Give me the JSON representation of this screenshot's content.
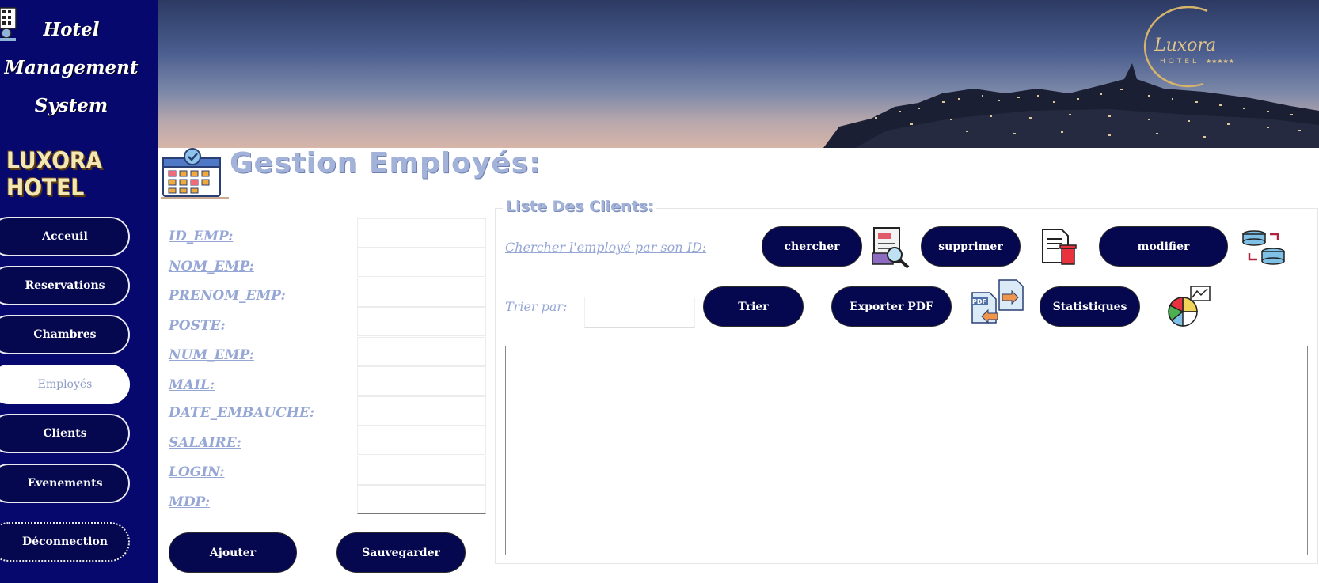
{
  "app": {
    "title_line1": "Hotel",
    "title_line2": "Management",
    "title_line3": "System",
    "brand": "LUXORA HOTEL"
  },
  "sidebar": {
    "items": [
      {
        "label": "Acceuil"
      },
      {
        "label": "Reservations"
      },
      {
        "label": "Chambres"
      },
      {
        "label": "Employés",
        "active": true
      },
      {
        "label": "Clients"
      },
      {
        "label": "Evenements"
      },
      {
        "label": "Déconnection"
      }
    ]
  },
  "header": {
    "logo_script": "Luxora",
    "logo_sub": "HOTEL",
    "logo_stars": "★★★★★"
  },
  "page": {
    "title": "Gestion Employés:"
  },
  "form": {
    "fields": [
      {
        "label": "ID_EMP:",
        "value": ""
      },
      {
        "label": "NOM_EMP:",
        "value": ""
      },
      {
        "label": "PRENOM_EMP:",
        "value": ""
      },
      {
        "label": "POSTE:",
        "value": ""
      },
      {
        "label": "NUM_EMP:",
        "value": ""
      },
      {
        "label": "MAIL:",
        "value": ""
      },
      {
        "label": "DATE_EMBAUCHE:",
        "value": ""
      },
      {
        "label": "SALAIRE:",
        "value": ""
      },
      {
        "label": "LOGIN:",
        "value": ""
      },
      {
        "label": "MDP:",
        "value": ""
      }
    ],
    "add_label": "Ajouter",
    "save_label": "Sauvegarder"
  },
  "panel": {
    "legend": "Liste Des Clients:",
    "search_label": "Chercher l'employé par son ID:",
    "search_button": "chercher",
    "delete_button": "supprimer",
    "modify_button": "modifier",
    "sort_label": "Trier par:",
    "sort_value": "",
    "sort_button": "Trier",
    "export_button": "Exporter PDF",
    "stats_button": "Statistiques",
    "pdf_icon_text": "PDF"
  },
  "colors": {
    "sidebar_bg": "#07086e",
    "button_bg": "#06084f",
    "label_color": "#96a7d6",
    "title_color": "#a3b2d8"
  }
}
